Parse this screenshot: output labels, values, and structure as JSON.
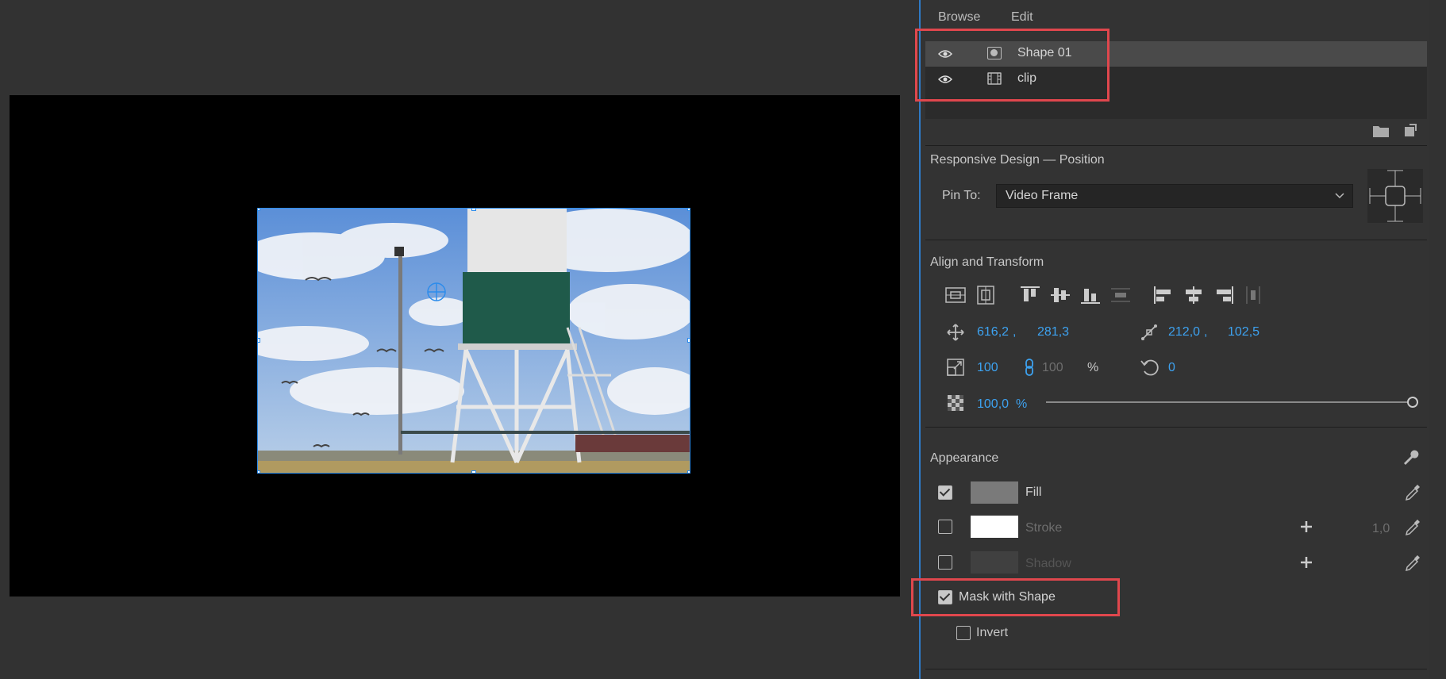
{
  "tabs": {
    "browse": "Browse",
    "edit": "Edit"
  },
  "layers": [
    {
      "name": "Shape 01",
      "icon": "shape-layer-icon",
      "selected": true
    },
    {
      "name": "clip",
      "icon": "film-layer-icon",
      "selected": false
    }
  ],
  "responsive": {
    "title": "Responsive Design — Position",
    "pin_label": "Pin To:",
    "pin_value": "Video Frame"
  },
  "align": {
    "title": "Align and Transform",
    "pos_x": "616,2",
    "pos_y": "281,3",
    "anchor_x": "212,0",
    "anchor_y": "102,5",
    "scale_w": "100",
    "scale_h": "100",
    "scale_unit": "%",
    "rotation": "0",
    "opacity": "100,0",
    "opacity_unit": "%",
    "opacity_level": 1.0,
    "comma": ","
  },
  "appearance": {
    "title": "Appearance",
    "fill_label": "Fill",
    "fill_checked": true,
    "fill_color": "#7a7a7a",
    "stroke_label": "Stroke",
    "stroke_checked": false,
    "stroke_color": "#ffffff",
    "stroke_width": "1,0",
    "shadow_label": "Shadow",
    "shadow_checked": false,
    "shadow_color": "#404040",
    "mask_label": "Mask with Shape",
    "mask_checked": true,
    "invert_label": "Invert",
    "invert_checked": false
  },
  "colors": {
    "accent": "#3da2f0",
    "highlight": "#e0474d",
    "selection": "#2d8ceb"
  }
}
